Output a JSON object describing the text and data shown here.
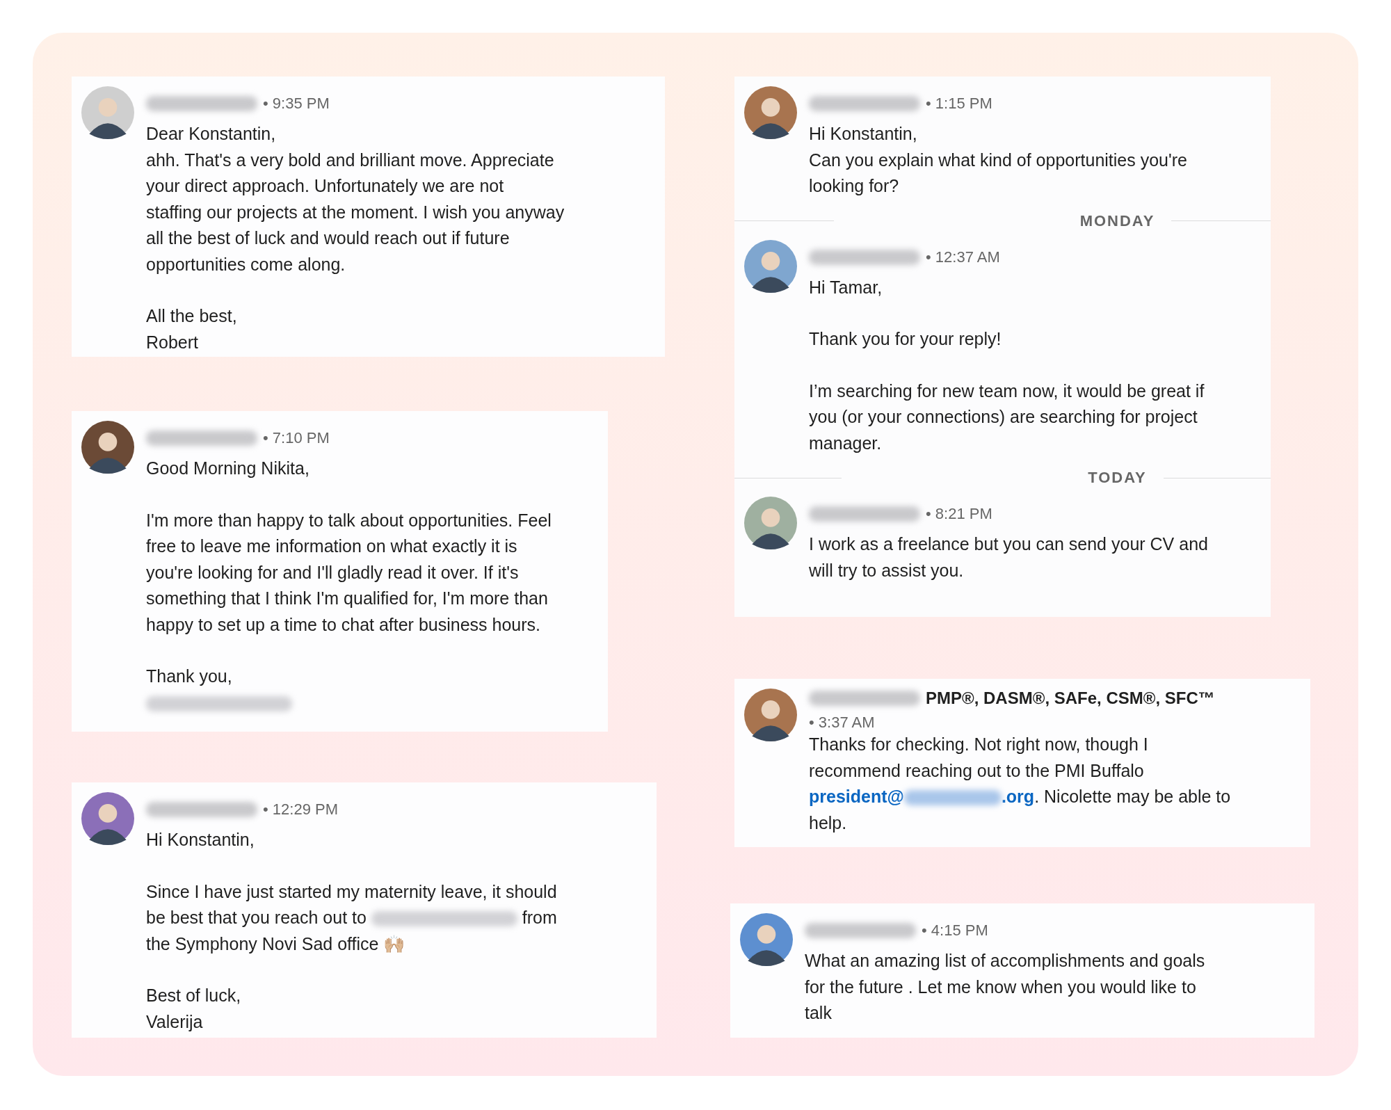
{
  "cards": [
    {
      "items": [
        {
          "kind": "message",
          "time": "• 9:35 PM",
          "paragraphs": [
            [
              "Dear Konstantin,",
              "ahh. That's a very bold and brilliant move. Appreciate",
              "your direct approach. Unfortunately we are not",
              "staffing our projects at the moment. I wish you anyway",
              "all the best of luck and would reach out if future",
              "opportunities come along."
            ],
            [
              "All the best,",
              "Robert"
            ]
          ]
        }
      ]
    },
    {
      "items": [
        {
          "kind": "message",
          "time": "• 7:10 PM",
          "paragraphs": [
            [
              "Good Morning Nikita,"
            ],
            [
              "I'm more than happy to talk about opportunities.  Feel",
              "free to leave me information on what exactly it is",
              "you're looking for and I'll gladly read it over.  If it's",
              "something that I think I'm qualified for, I'm more than",
              "happy to set up a time to chat after business hours."
            ],
            [
              "Thank you,",
              [
                {
                  "kind": "redacted"
                }
              ]
            ]
          ]
        }
      ]
    },
    {
      "items": [
        {
          "kind": "message",
          "time": "• 12:29 PM",
          "paragraphs": [
            [
              "Hi Konstantin,"
            ],
            [
              "Since I have just started my maternity leave, it should",
              [
                {
                  "kind": "text",
                  "text": "be best that you reach out to "
                },
                {
                  "kind": "redacted"
                },
                {
                  "kind": "text",
                  "text": " from"
                }
              ],
              "the Symphony Novi Sad office 🙌🏼"
            ],
            [
              "Best of luck,",
              "Valerija"
            ]
          ]
        }
      ]
    },
    {
      "items": [
        {
          "kind": "message",
          "time": "• 1:15 PM",
          "paragraphs": [
            [
              "Hi Konstantin,",
              "Can you explain what kind of opportunities you're",
              "looking for?"
            ]
          ]
        },
        {
          "kind": "divider",
          "label": "MONDAY"
        },
        {
          "kind": "message",
          "time": "• 12:37 AM",
          "paragraphs": [
            [
              "Hi Tamar,"
            ],
            [
              "Thank you for your reply!"
            ],
            [
              "I’m searching for new team now, it would be great if",
              "you (or your connections) are searching for project",
              "manager."
            ]
          ]
        },
        {
          "kind": "divider",
          "label": "TODAY"
        },
        {
          "kind": "message",
          "time": "• 8:21 PM",
          "paragraphs": [
            [
              "I work as a freelance but you can send your CV and",
              "will try to assist you."
            ]
          ]
        }
      ]
    },
    {
      "items": [
        {
          "kind": "message",
          "credentials": "PMP®, DASM®, SAFe, CSM®, SFC™",
          "time": "• 3:37 AM",
          "paragraphs": [
            [
              "Thanks for checking. Not right now, though I",
              "recommend reaching out to the PMI Buffalo",
              [
                {
                  "kind": "link",
                  "text": "president@"
                },
                {
                  "kind": "redacted-link"
                },
                {
                  "kind": "link",
                  "text": ".org"
                },
                {
                  "kind": "text",
                  "text": ". Nicolette may be able to"
                }
              ],
              "help."
            ]
          ]
        }
      ]
    },
    {
      "items": [
        {
          "kind": "message",
          "time": "• 4:15 PM",
          "paragraphs": [
            [
              "What an amazing list of accomplishments and goals",
              "for the future . Let me know when you would like to",
              "talk"
            ]
          ]
        }
      ]
    }
  ]
}
